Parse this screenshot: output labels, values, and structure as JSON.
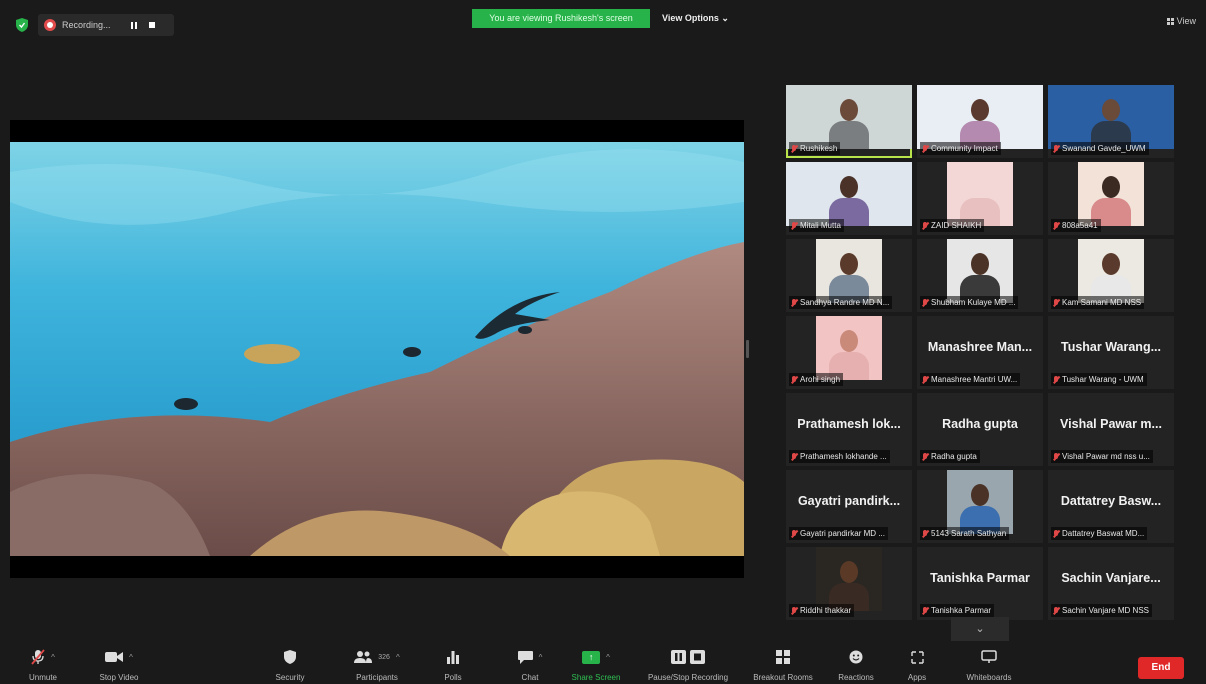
{
  "topbar": {
    "recording_label": "Recording...",
    "viewing_banner": "You are viewing Rushikesh's screen",
    "view_options": "View Options",
    "view_button": "View"
  },
  "colors": {
    "accent_green": "#27b24a",
    "active_speaker": "#b8e34a",
    "muted_red": "#e04848",
    "end_red": "#e02828"
  },
  "gallery": {
    "tiles": [
      {
        "label": "Rushikesh",
        "big": "",
        "video": "man-grey-shirt",
        "active": true
      },
      {
        "label": "Community Impact",
        "big": "",
        "video": "woman-banner"
      },
      {
        "label": "Swanand Gavde_UWM",
        "big": "",
        "video": "man-blue-live-united"
      },
      {
        "label": "Mitali Mutta",
        "big": "",
        "video": "woman-blue-banner"
      },
      {
        "label": "ZAID SHAIKH",
        "big": "",
        "video": "pink-ceiling"
      },
      {
        "label": "808a5a41",
        "big": "",
        "video": "woman-orange"
      },
      {
        "label": "Sandhya Randre MD N...",
        "big": "",
        "video": "woman-light"
      },
      {
        "label": "Shubham Kulaye MD ...",
        "big": "",
        "video": "man-dark"
      },
      {
        "label": "Kam Samani MD NSS",
        "big": "",
        "video": "man-light"
      },
      {
        "label": "Arohi singh",
        "big": "",
        "video": "pink-room"
      },
      {
        "label": "Manashree Mantri UW...",
        "big": "Manashree Man...",
        "video": ""
      },
      {
        "label": "Tushar Warang - UWM",
        "big": "Tushar Warang...",
        "video": ""
      },
      {
        "label": "Prathamesh lokhande ...",
        "big": "Prathamesh lok...",
        "video": ""
      },
      {
        "label": "Radha gupta",
        "big": "Radha gupta",
        "video": ""
      },
      {
        "label": "Vishal Pawar md nss u...",
        "big": "Vishal Pawar m...",
        "video": ""
      },
      {
        "label": "Gayatri pandirkar MD ...",
        "big": "Gayatri pandirk...",
        "video": ""
      },
      {
        "label": "5143 Sarath Sathyan",
        "big": "",
        "video": "man-blue"
      },
      {
        "label": "Dattatrey Baswat MD...",
        "big": "Dattatrey Basw...",
        "video": ""
      },
      {
        "label": "Riddhi thakkar",
        "big": "",
        "video": "girl-dark"
      },
      {
        "label": "Tanishka Parmar",
        "big": "Tanishka Parmar",
        "video": ""
      },
      {
        "label": "Sachin Vanjare MD NSS",
        "big": "Sachin Vanjare...",
        "video": ""
      }
    ],
    "more_icon": "chevron-down-icon"
  },
  "toolbar": {
    "unmute": "Unmute",
    "stop_video": "Stop Video",
    "security": "Security",
    "participants": "Participants",
    "participants_count": "326",
    "polls": "Polls",
    "chat": "Chat",
    "share_screen": "Share Screen",
    "pause_stop_recording": "Pause/Stop Recording",
    "breakout_rooms": "Breakout Rooms",
    "reactions": "Reactions",
    "apps": "Apps",
    "whiteboards": "Whiteboards",
    "end": "End"
  }
}
